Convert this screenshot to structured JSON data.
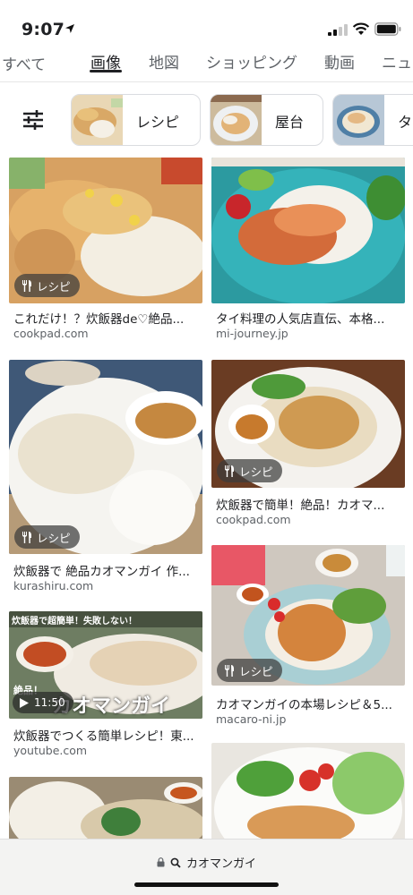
{
  "status_bar": {
    "time": "9:07"
  },
  "tabs": [
    {
      "label": "すべて",
      "active": false
    },
    {
      "label": "画像",
      "active": true
    },
    {
      "label": "地図",
      "active": false
    },
    {
      "label": "ショッピング",
      "active": false
    },
    {
      "label": "動画",
      "active": false
    },
    {
      "label": "ニュ",
      "active": false
    }
  ],
  "chips": [
    {
      "label": "レシピ"
    },
    {
      "label": "屋台"
    },
    {
      "label": "タ"
    }
  ],
  "results": [
    {
      "title": "これだけ！？炊飯器de♡絶品...",
      "domain": "cookpad.com",
      "badge": "レシピ"
    },
    {
      "title": "タイ料理の人気店直伝、本格...",
      "domain": "mi-journey.jp"
    },
    {
      "title": "炊飯器で 絶品カオマンガイ 作...",
      "domain": "kurashiru.com",
      "badge": "レシピ"
    },
    {
      "title": "炊飯器で簡単！絶品！カオマ...",
      "domain": "cookpad.com",
      "badge": "レシピ"
    },
    {
      "title": "炊飯器でつくる簡単レシピ！東...",
      "domain": "youtube.com",
      "duration": "11:50",
      "overlay_top": "炊飯器で超簡単！失敗しない！",
      "overlay_left": "絶品！",
      "overlay_big": "カオマンガイ"
    },
    {
      "title": "カオマンガイの本場レシピ＆5...",
      "domain": "macaro-ni.jp",
      "badge": "レシピ"
    }
  ],
  "address_bar": {
    "query": "カオマンガイ"
  },
  "colors": {
    "accent": "#202124",
    "muted": "#5f6368",
    "badge_bg": "#3c3c3c"
  }
}
